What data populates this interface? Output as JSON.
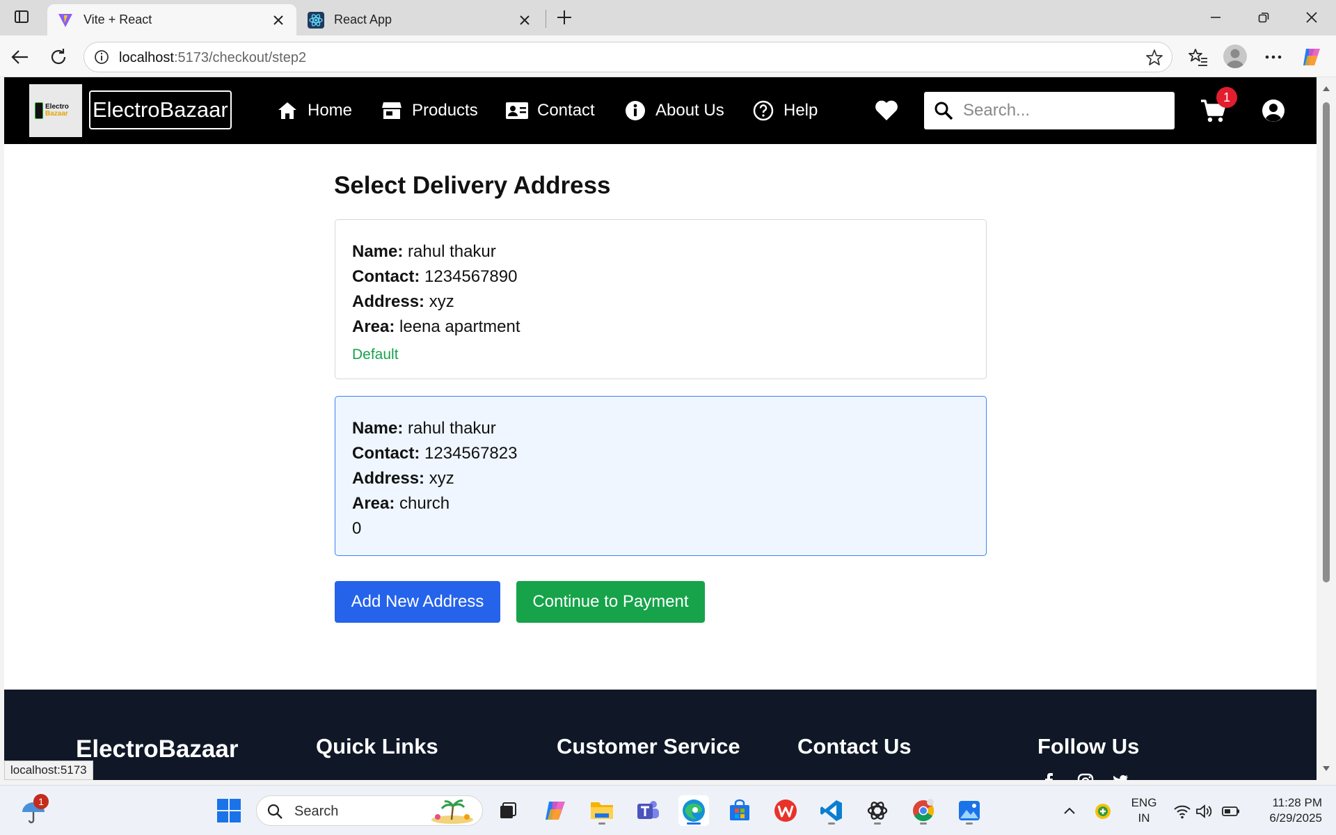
{
  "browser": {
    "tabs": [
      {
        "title": "Vite + React",
        "active": true
      },
      {
        "title": "React App",
        "active": false
      }
    ],
    "url_host": "localhost",
    "url_path": ":5173/checkout/step2",
    "status_url": "localhost:5173"
  },
  "site": {
    "logo_line1": "Electro",
    "logo_line2": "Bazaar",
    "brand": "ElectroBazaar",
    "nav": [
      {
        "label": "Home",
        "icon": "home-icon"
      },
      {
        "label": "Products",
        "icon": "store-icon"
      },
      {
        "label": "Contact",
        "icon": "contact-card-icon"
      },
      {
        "label": "About Us",
        "icon": "info-icon"
      },
      {
        "label": "Help",
        "icon": "help-icon"
      }
    ],
    "search_placeholder": "Search...",
    "cart_count": "1"
  },
  "checkout": {
    "title": "Select Delivery Address",
    "field_labels": {
      "name": "Name:",
      "contact": "Contact:",
      "address": "Address:",
      "area": "Area:"
    },
    "addresses": [
      {
        "name": "rahul thakur",
        "contact": "1234567890",
        "address": "xyz",
        "area": "leena apartment",
        "tag": "Default",
        "selected": false
      },
      {
        "name": "rahul thakur",
        "contact": "1234567823",
        "address": "xyz",
        "area": "church",
        "extra": "0",
        "selected": true
      }
    ],
    "add_button": "Add New Address",
    "continue_button": "Continue to Payment"
  },
  "footer": {
    "brand": "ElectroBazaar",
    "columns": [
      "Quick Links",
      "Customer Service",
      "Contact Us",
      "Follow Us"
    ]
  },
  "taskbar": {
    "search_label": "Search",
    "weather_badge": "1",
    "lang_line1": "ENG",
    "lang_line2": "IN",
    "time": "11:28 PM",
    "date": "6/29/2025"
  },
  "colors": {
    "primary_blue": "#2563eb",
    "success_green": "#16a34a",
    "nav_bg": "#000000",
    "footer_bg": "#101828",
    "badge_red": "#e11d2e"
  }
}
